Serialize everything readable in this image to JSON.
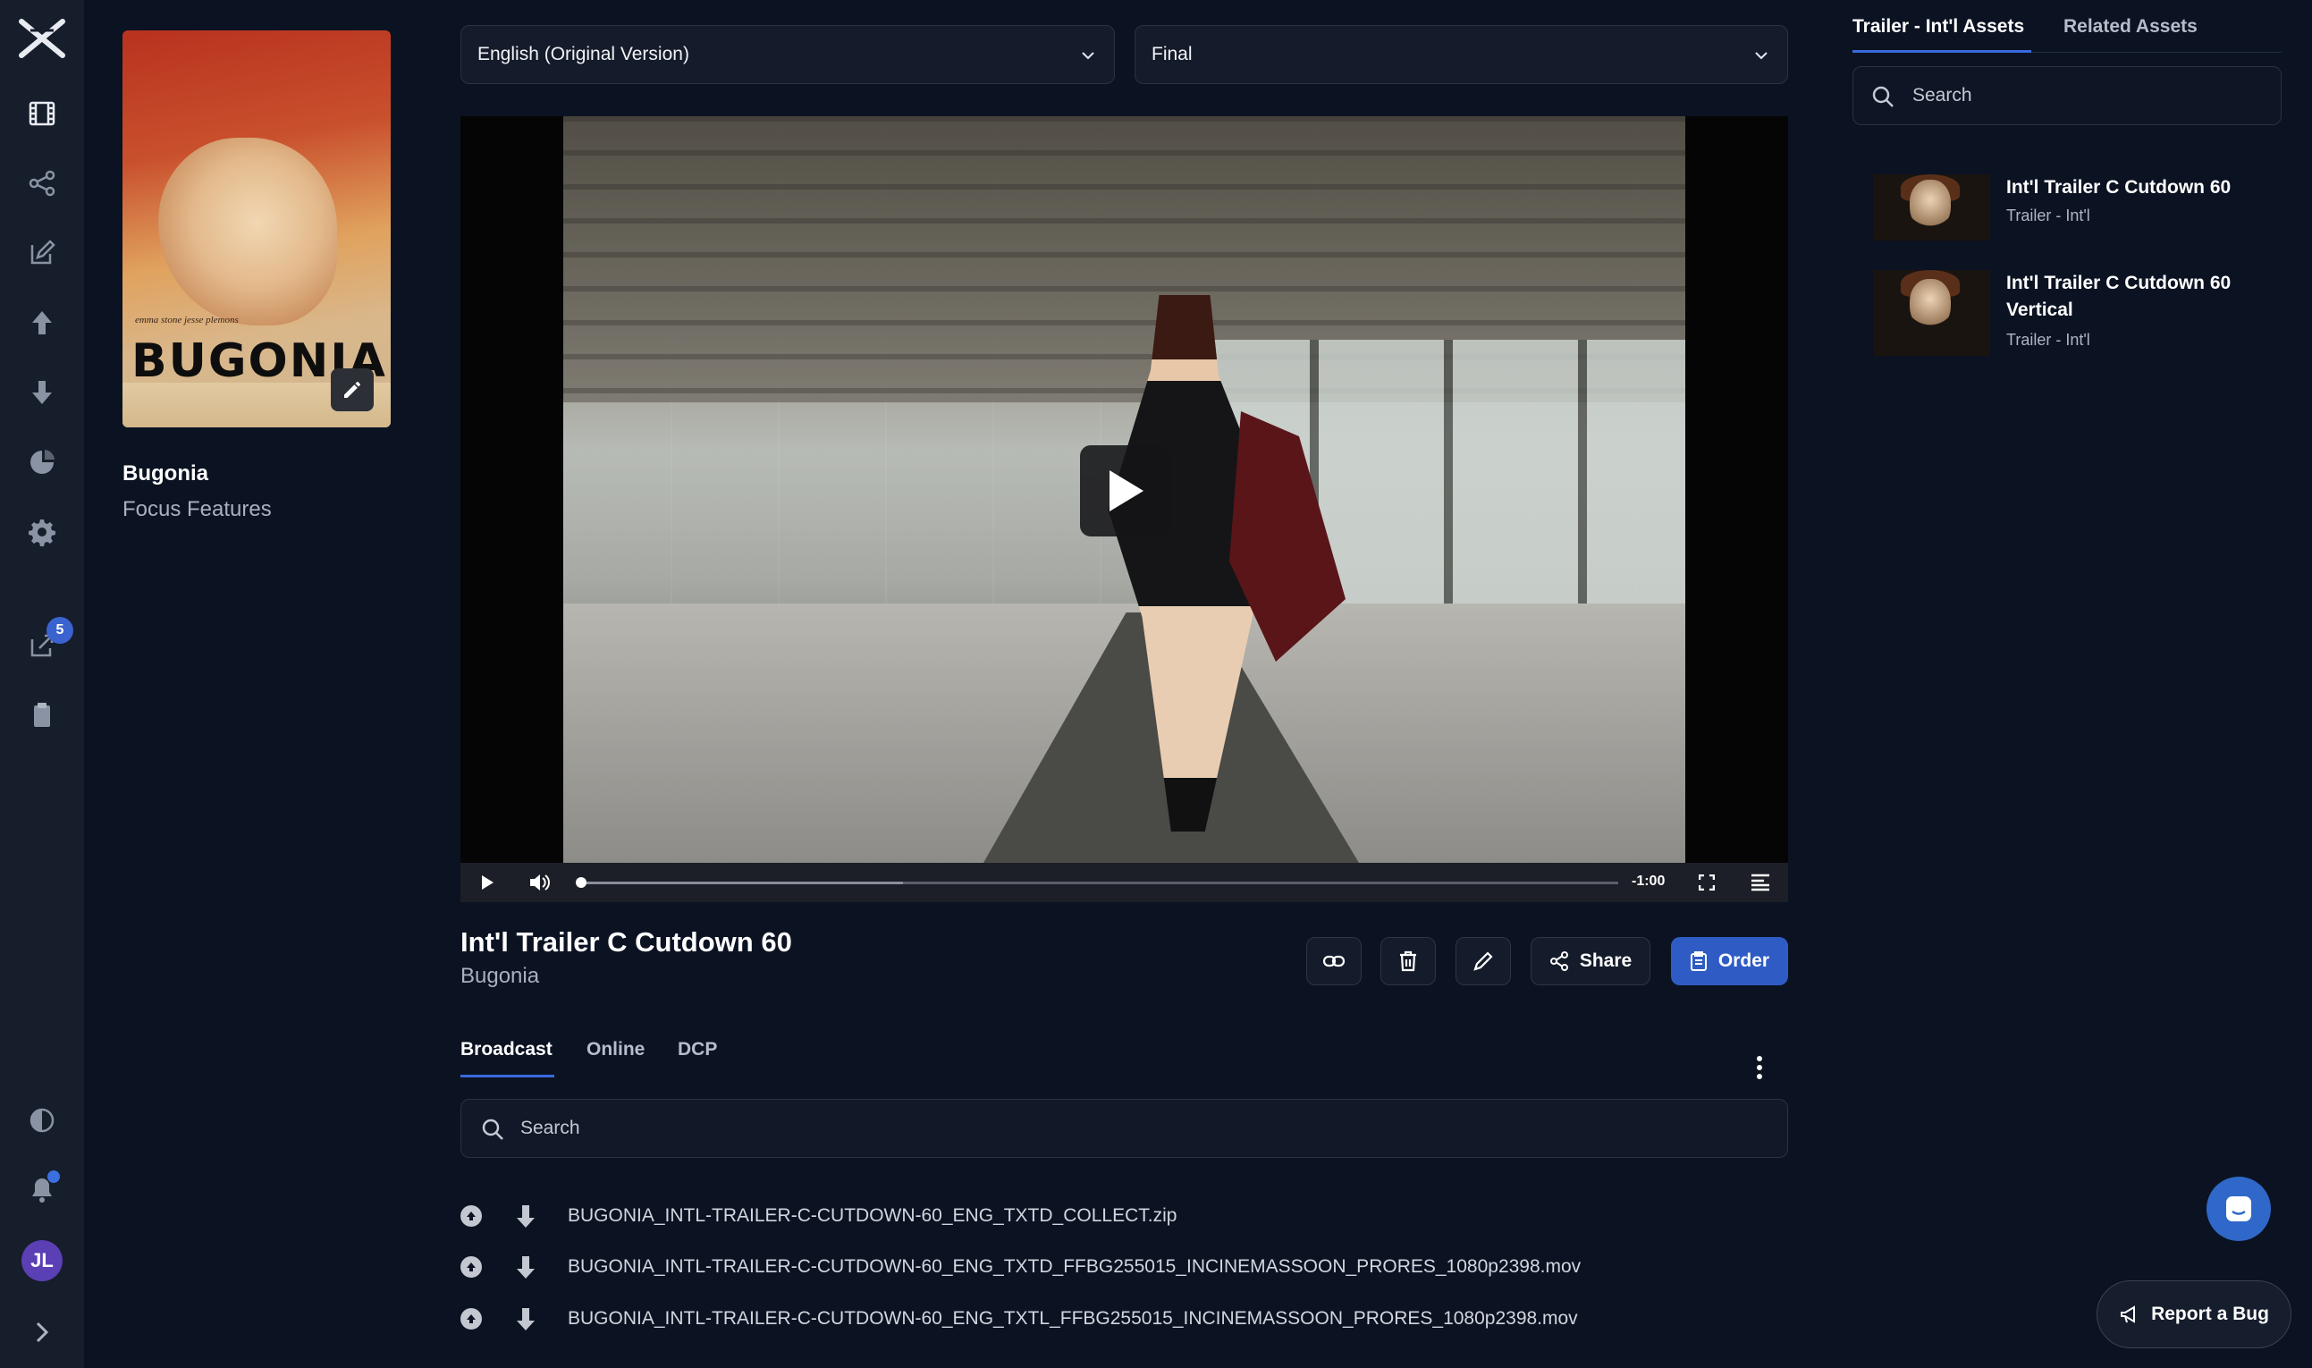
{
  "sidebar": {
    "badge_count": "5",
    "avatar_initials": "JL"
  },
  "film": {
    "poster_credits": "emma stone   jesse plemons",
    "poster_title": "BUGONIA",
    "title": "Bugonia",
    "studio": "Focus Features"
  },
  "selects": {
    "language": "English (Original Version)",
    "version": "Final"
  },
  "player": {
    "time_remaining": "-1:00"
  },
  "asset": {
    "title": "Int'l Trailer C Cutdown 60",
    "subtitle": "Bugonia",
    "share_label": "Share",
    "order_label": "Order"
  },
  "tabs": [
    "Broadcast",
    "Online",
    "DCP"
  ],
  "files_search_placeholder": "Search",
  "files": [
    "BUGONIA_INTL-TRAILER-C-CUTDOWN-60_ENG_TXTD_COLLECT.zip",
    "BUGONIA_INTL-TRAILER-C-CUTDOWN-60_ENG_TXTD_FFBG255015_INCINEMASSOON_PRORES_1080p2398.mov",
    "BUGONIA_INTL-TRAILER-C-CUTDOWN-60_ENG_TXTL_FFBG255015_INCINEMASSOON_PRORES_1080p2398.mov"
  ],
  "right_panel": {
    "tabs": [
      "Trailer - Int'l Assets",
      "Related Assets"
    ],
    "search_placeholder": "Search",
    "items": [
      {
        "title": "Int'l Trailer C Cutdown 60",
        "subtitle": "Trailer - Int'l"
      },
      {
        "title": "Int'l Trailer C Cutdown 60 Vertical",
        "subtitle": "Trailer - Int'l"
      }
    ]
  },
  "report_bug_label": "Report a Bug",
  "colors": {
    "background": "#0b1222",
    "rail": "#161d2b",
    "accent": "#2f5cc4",
    "tab_underline": "#3a6ae0"
  }
}
